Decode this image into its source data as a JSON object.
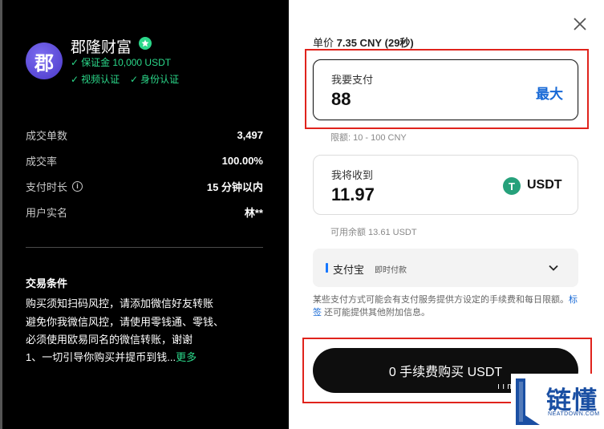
{
  "merchant": {
    "avatar_char": "郡",
    "name": "郡隆财富",
    "certifications": {
      "deposit": "保证金 10,000 USDT",
      "video": "视频认证",
      "identity": "身份认证"
    }
  },
  "stats": [
    {
      "label": "成交单数",
      "value": "3,497"
    },
    {
      "label": "成交率",
      "value": "100.00%"
    },
    {
      "label": "支付时长",
      "value": "15 分钟以内"
    },
    {
      "label": "用户实名",
      "value": "林**"
    }
  ],
  "terms": {
    "title": "交易条件",
    "lines": [
      "购买须知扫码风控，请添加微信好友转账",
      "避免你我微信风控，请使用零钱通、零钱、",
      "必须使用欧易同名的微信转账，谢谢",
      "1、一切引导你购买并提币到钱..."
    ],
    "more_label": "更多"
  },
  "order": {
    "unit_price_label": "单价",
    "unit_price": "7.35 CNY",
    "countdown": "(29秒)",
    "pay_label": "我要支付",
    "pay_amount": "88",
    "max_label": "最大",
    "limit_hint": "限额: 10 - 100 CNY",
    "receive_label": "我将收到",
    "receive_amount": "11.97",
    "receive_currency": "USDT",
    "usdt_icon_char": "T",
    "balance_hint": "可用余额 13.61 USDT"
  },
  "payment_method": {
    "name": "支付宝",
    "tag": "即时付款"
  },
  "notice": {
    "text_before": "某些支付方式可能会有支付服务提供方设定的手续费和每日限额。",
    "link": "标签",
    "text_after": " 还可能提供其他附加信息。"
  },
  "buy_button": {
    "label": "0 手续费购买 USDT",
    "stray_text": "ı ı m"
  },
  "watermark": {
    "title": "链懂",
    "subtitle": "NEATDOWN.COM"
  },
  "colors": {
    "accent_green": "#2bd88a",
    "link_blue": "#1769d6",
    "highlight_red": "#e0231c",
    "usdt_green": "#26a17b"
  },
  "icons": [
    "close-icon",
    "verified-icon",
    "check-icon",
    "info-icon",
    "chevron-down-icon",
    "usdt-icon"
  ]
}
